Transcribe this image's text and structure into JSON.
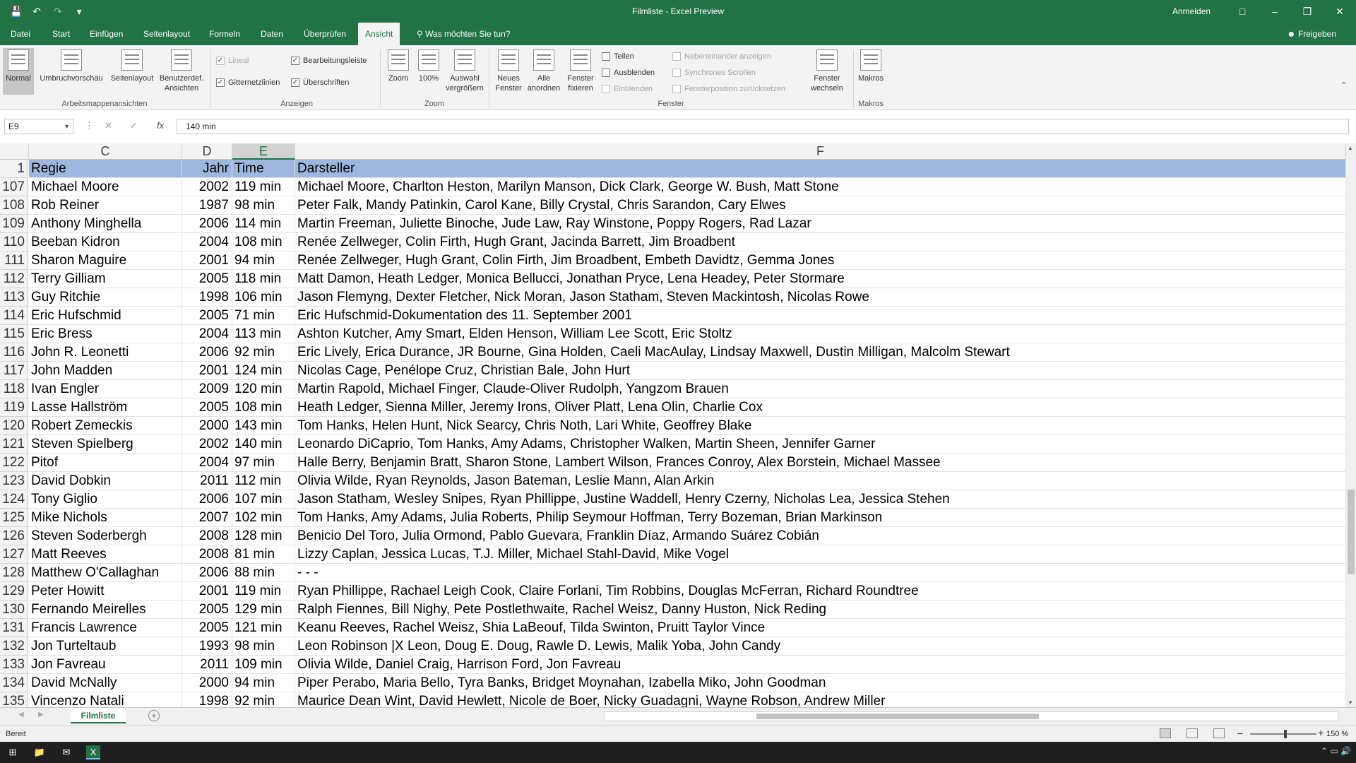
{
  "window": {
    "title": "Filmliste - Excel Preview",
    "sign_in": "Anmelden",
    "qat_icons": [
      "save-icon",
      "undo-icon",
      "redo-icon",
      "customize-icon"
    ]
  },
  "ribbon_tabs": [
    "Datei",
    "Start",
    "Einfügen",
    "Seitenlayout",
    "Formeln",
    "Daten",
    "Überprüfen",
    "Ansicht"
  ],
  "active_tab": "Ansicht",
  "tell_me": "Was möchten Sie tun?",
  "share_label": "Freigeben",
  "ribbon": {
    "workbook_views": {
      "label": "Arbeitsmappenansichten",
      "buttons": [
        "Normal",
        "Umbruchvorschau",
        "Seitenlayout",
        "Benutzerdef. Ansichten"
      ]
    },
    "show": {
      "label": "Anzeigen",
      "lineal": "Lineal",
      "bearbeitungsleiste": "Bearbeitungsleiste",
      "gitternetzlinien": "Gitternetzlinien",
      "ueberschriften": "Überschriften"
    },
    "zoom": {
      "label": "Zoom",
      "buttons": [
        "Zoom",
        "100%",
        "Auswahl vergrößern"
      ]
    },
    "window_group": {
      "label": "Fenster",
      "buttons": [
        "Neues Fenster",
        "Alle anordnen",
        "Fenster fixieren"
      ],
      "small": [
        "Teilen",
        "Ausblenden",
        "Einblenden"
      ],
      "disabled": [
        "Nebeneinander anzeigen",
        "Synchrones Scrollen",
        "Fensterposition zurücksetzen"
      ],
      "switch": "Fenster wechseln"
    },
    "macros": {
      "label": "Makros",
      "button": "Makros"
    }
  },
  "formula_bar": {
    "name_box": "E9",
    "value": "140 min"
  },
  "columns": [
    "C",
    "D",
    "E",
    "F"
  ],
  "selected_column": "E",
  "header_row": {
    "num": "1",
    "cells": [
      "Regie",
      "Jahr",
      "Time",
      "Darsteller"
    ]
  },
  "rows": [
    {
      "num": "107",
      "cells": [
        "Michael Moore",
        "2002",
        "119 min",
        "Michael Moore, Charlton Heston, Marilyn Manson, Dick Clark, George W. Bush, Matt Stone"
      ]
    },
    {
      "num": "108",
      "cells": [
        "Rob Reiner",
        "1987",
        "98 min",
        "Peter Falk, Mandy Patinkin, Carol Kane, Billy Crystal, Chris Sarandon, Cary Elwes"
      ]
    },
    {
      "num": "109",
      "cells": [
        "Anthony Minghella",
        "2006",
        "114 min",
        "Martin Freeman, Juliette Binoche, Jude Law, Ray Winstone, Poppy Rogers, Rad Lazar"
      ]
    },
    {
      "num": "110",
      "cells": [
        "Beeban Kidron",
        "2004",
        "108 min",
        "Renée Zellweger, Colin Firth, Hugh Grant, Jacinda Barrett, Jim Broadbent"
      ]
    },
    {
      "num": "111",
      "cells": [
        "Sharon Maguire",
        "2001",
        "94 min",
        "Renée Zellweger, Hugh Grant, Colin Firth, Jim Broadbent, Embeth Davidtz, Gemma Jones"
      ]
    },
    {
      "num": "112",
      "cells": [
        "Terry Gilliam",
        "2005",
        "118 min",
        "Matt Damon, Heath Ledger, Monica Bellucci, Jonathan Pryce, Lena Headey, Peter Stormare"
      ]
    },
    {
      "num": "113",
      "cells": [
        "Guy Ritchie",
        "1998",
        "106 min",
        "Jason Flemyng, Dexter Fletcher, Nick Moran, Jason Statham, Steven Mackintosh, Nicolas Rowe"
      ]
    },
    {
      "num": "114",
      "cells": [
        "Eric Hufschmid",
        "2005",
        "71 min",
        "Eric Hufschmid-Dokumentation des 11. September 2001"
      ]
    },
    {
      "num": "115",
      "cells": [
        "Eric Bress",
        "2004",
        "113 min",
        "Ashton Kutcher, Amy Smart, Elden Henson, William Lee Scott, Eric Stoltz"
      ]
    },
    {
      "num": "116",
      "cells": [
        "John R. Leonetti",
        "2006",
        "92 min",
        "Eric Lively, Erica Durance, JR Bourne, Gina Holden, Caeli MacAulay, Lindsay Maxwell, Dustin Milligan, Malcolm Stewart"
      ]
    },
    {
      "num": "117",
      "cells": [
        "John Madden",
        "2001",
        "124 min",
        "Nicolas Cage, Penélope Cruz, Christian Bale, John Hurt"
      ]
    },
    {
      "num": "118",
      "cells": [
        "Ivan Engler",
        "2009",
        "120 min",
        "Martin Rapold, Michael Finger, Claude-Oliver Rudolph, Yangzom Brauen"
      ]
    },
    {
      "num": "119",
      "cells": [
        "Lasse Hallström",
        "2005",
        "108 min",
        "Heath Ledger, Sienna Miller, Jeremy Irons, Oliver Platt, Lena Olin, Charlie Cox"
      ]
    },
    {
      "num": "120",
      "cells": [
        "Robert Zemeckis",
        "2000",
        "143 min",
        "Tom Hanks, Helen Hunt, Nick Searcy, Chris Noth, Lari White, Geoffrey Blake"
      ]
    },
    {
      "num": "121",
      "cells": [
        "Steven Spielberg",
        "2002",
        "140 min",
        "Leonardo DiCaprio, Tom Hanks, Amy Adams, Christopher Walken, Martin Sheen, Jennifer Garner"
      ]
    },
    {
      "num": "122",
      "cells": [
        "Pitof",
        "2004",
        "97 min",
        "Halle Berry, Benjamin Bratt, Sharon Stone, Lambert Wilson, Frances Conroy, Alex Borstein, Michael Massee"
      ]
    },
    {
      "num": "123",
      "cells": [
        "David Dobkin",
        "2011",
        "112 min",
        "Olivia Wilde, Ryan Reynolds, Jason Bateman, Leslie Mann, Alan Arkin"
      ]
    },
    {
      "num": "124",
      "cells": [
        "Tony Giglio",
        "2006",
        "107 min",
        "Jason Statham, Wesley Snipes, Ryan Phillippe, Justine Waddell, Henry Czerny, Nicholas Lea, Jessica Stehen"
      ]
    },
    {
      "num": "125",
      "cells": [
        "Mike Nichols",
        "2007",
        "102 min",
        "Tom Hanks, Amy Adams, Julia Roberts, Philip Seymour Hoffman, Terry Bozeman, Brian Markinson"
      ]
    },
    {
      "num": "126",
      "cells": [
        "Steven Soderbergh",
        "2008",
        "128 min",
        "Benicio Del Toro, Julia Ormond, Pablo Guevara, Franklin Díaz, Armando Suárez Cobián"
      ]
    },
    {
      "num": "127",
      "cells": [
        "Matt Reeves",
        "2008",
        "81 min",
        "Lizzy Caplan, Jessica Lucas, T.J. Miller, Michael Stahl-David, Mike Vogel"
      ]
    },
    {
      "num": "128",
      "cells": [
        "Matthew O'Callaghan",
        "2006",
        "88 min",
        "- - -"
      ]
    },
    {
      "num": "129",
      "cells": [
        "Peter Howitt",
        "2001",
        "119 min",
        "Ryan Phillippe, Rachael Leigh Cook, Claire Forlani, Tim Robbins, Douglas McFerran, Richard Roundtree"
      ]
    },
    {
      "num": "130",
      "cells": [
        "Fernando Meirelles",
        "2005",
        "129 min",
        "Ralph Fiennes, Bill Nighy, Pete Postlethwaite, Rachel Weisz, Danny Huston, Nick Reding"
      ]
    },
    {
      "num": "131",
      "cells": [
        "Francis Lawrence",
        "2005",
        "121 min",
        "Keanu Reeves, Rachel Weisz, Shia LaBeouf, Tilda Swinton, Pruitt Taylor Vince"
      ]
    },
    {
      "num": "132",
      "cells": [
        "Jon Turteltaub",
        "1993",
        "98 min",
        "Leon Robinson |X Leon, Doug E. Doug, Rawle D. Lewis, Malik Yoba, John Candy"
      ]
    },
    {
      "num": "133",
      "cells": [
        "Jon Favreau",
        "2011",
        "109 min",
        "Olivia Wilde, Daniel Craig, Harrison Ford, Jon Favreau"
      ]
    },
    {
      "num": "134",
      "cells": [
        "David McNally",
        "2000",
        "94 min",
        "Piper Perabo, Maria Bello, Tyra Banks, Bridget Moynahan, Izabella Miko, John Goodman"
      ]
    },
    {
      "num": "135",
      "cells": [
        "Vincenzo Natali",
        "1998",
        "92 min",
        "Maurice Dean Wint, David Hewlett, Nicole de Boer, Nicky Guadagni, Wayne Robson, Andrew Miller"
      ]
    }
  ],
  "sheet_tab": "Filmliste",
  "status": {
    "ready": "Bereit",
    "zoom": "150 %"
  },
  "colors": {
    "excel_green": "#217346",
    "header_row_fill": "#9db7de"
  }
}
